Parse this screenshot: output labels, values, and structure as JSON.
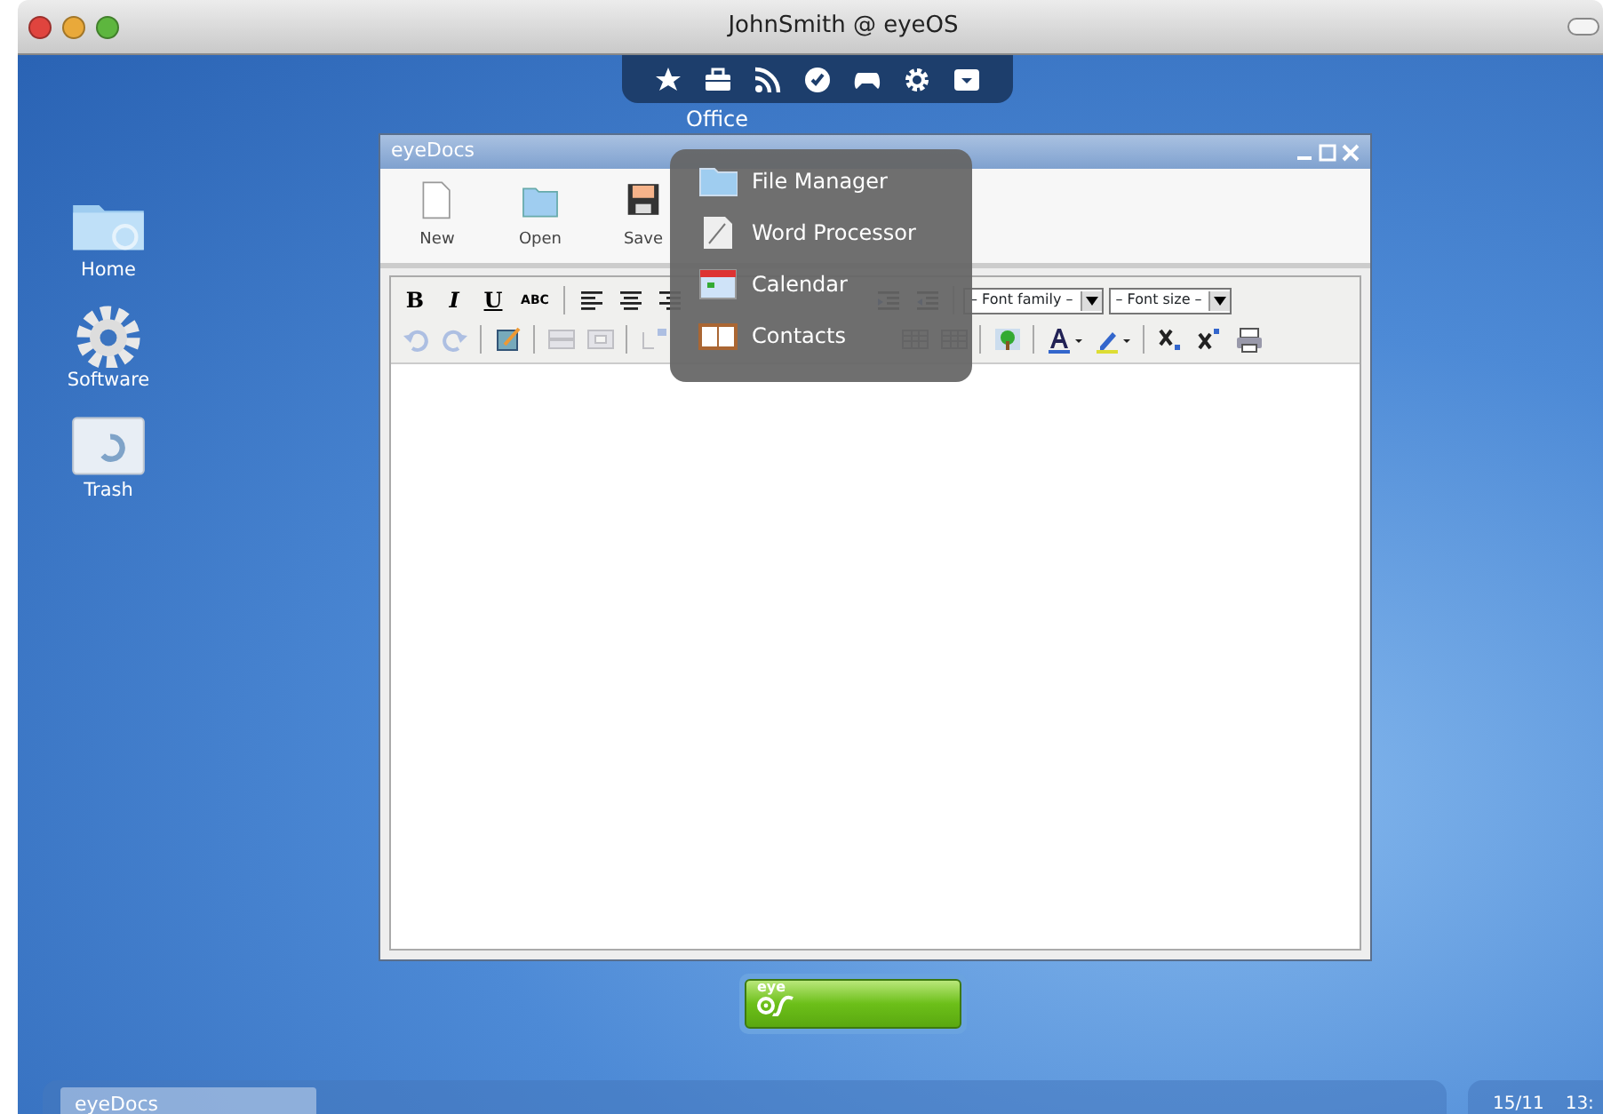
{
  "window": {
    "title": "JohnSmith @ eyeOS"
  },
  "dock": [
    {
      "kind": "star"
    },
    {
      "kind": "briefcase"
    },
    {
      "kind": "rss"
    },
    {
      "kind": "check"
    },
    {
      "kind": "gamepad"
    },
    {
      "kind": "gear"
    },
    {
      "kind": "tray"
    }
  ],
  "dock_label": "Office",
  "desktop_icons": [
    {
      "kind": "folder",
      "label": "Home"
    },
    {
      "kind": "gear",
      "label": "Software"
    },
    {
      "kind": "trash",
      "label": "Trash"
    }
  ],
  "app_window": {
    "title": "eyeDocs",
    "toolbar": [
      {
        "kind": "new",
        "label": "New"
      },
      {
        "kind": "open",
        "label": "Open"
      },
      {
        "kind": "save",
        "label": "Save"
      }
    ],
    "format_rows": [
      {
        "left": [
          {
            "kind": "text",
            "label": "B",
            "disabled": false
          },
          {
            "kind": "text",
            "label": "I",
            "disabled": false
          },
          {
            "kind": "text",
            "label": "U",
            "disabled": false
          },
          {
            "kind": "text",
            "label": "ABC",
            "disabled": false
          },
          {
            "kind": "separator"
          },
          {
            "kind": "align-left",
            "disabled": false
          },
          {
            "kind": "align-center",
            "disabled": false
          },
          {
            "kind": "align-right",
            "disabled": false
          }
        ],
        "right": [
          {
            "kind": "outdent"
          },
          {
            "kind": "indent"
          },
          {
            "kind": "separator"
          },
          {
            "kind": "select",
            "placeholder": "– Font family –"
          },
          {
            "kind": "select",
            "placeholder": "– Font size –"
          }
        ]
      },
      {
        "left": [
          {
            "kind": "undo",
            "disabled": true
          },
          {
            "kind": "redo",
            "disabled": true
          },
          {
            "kind": "separator"
          },
          {
            "kind": "edit",
            "disabled": false
          },
          {
            "kind": "separator"
          },
          {
            "kind": "table-row",
            "disabled": true
          },
          {
            "kind": "table-cell",
            "disabled": true
          },
          {
            "kind": "separator"
          },
          {
            "kind": "insert-row",
            "disabled": true
          }
        ],
        "right": [
          {
            "kind": "table"
          },
          {
            "kind": "table"
          },
          {
            "kind": "separator"
          },
          {
            "kind": "image",
            "disabled": false
          },
          {
            "kind": "separator"
          },
          {
            "kind": "font-color",
            "disabled": false
          },
          {
            "kind": "highlight",
            "disabled": false
          },
          {
            "kind": "separator"
          },
          {
            "kind": "subscript",
            "disabled": false
          },
          {
            "kind": "superscript",
            "disabled": false
          },
          {
            "kind": "print",
            "disabled": false
          }
        ]
      }
    ]
  },
  "office_menu": [
    {
      "kind": "folder",
      "label": "File Manager"
    },
    {
      "kind": "document",
      "label": "Word Processor"
    },
    {
      "kind": "calendar",
      "label": "Calendar"
    },
    {
      "kind": "book",
      "label": "Contacts"
    }
  ],
  "launcher": {
    "label": "eye"
  },
  "taskbar": {
    "tasks": [
      {
        "label": "eyeDocs",
        "selected": true
      }
    ],
    "date": "15/11",
    "time": "13:"
  }
}
